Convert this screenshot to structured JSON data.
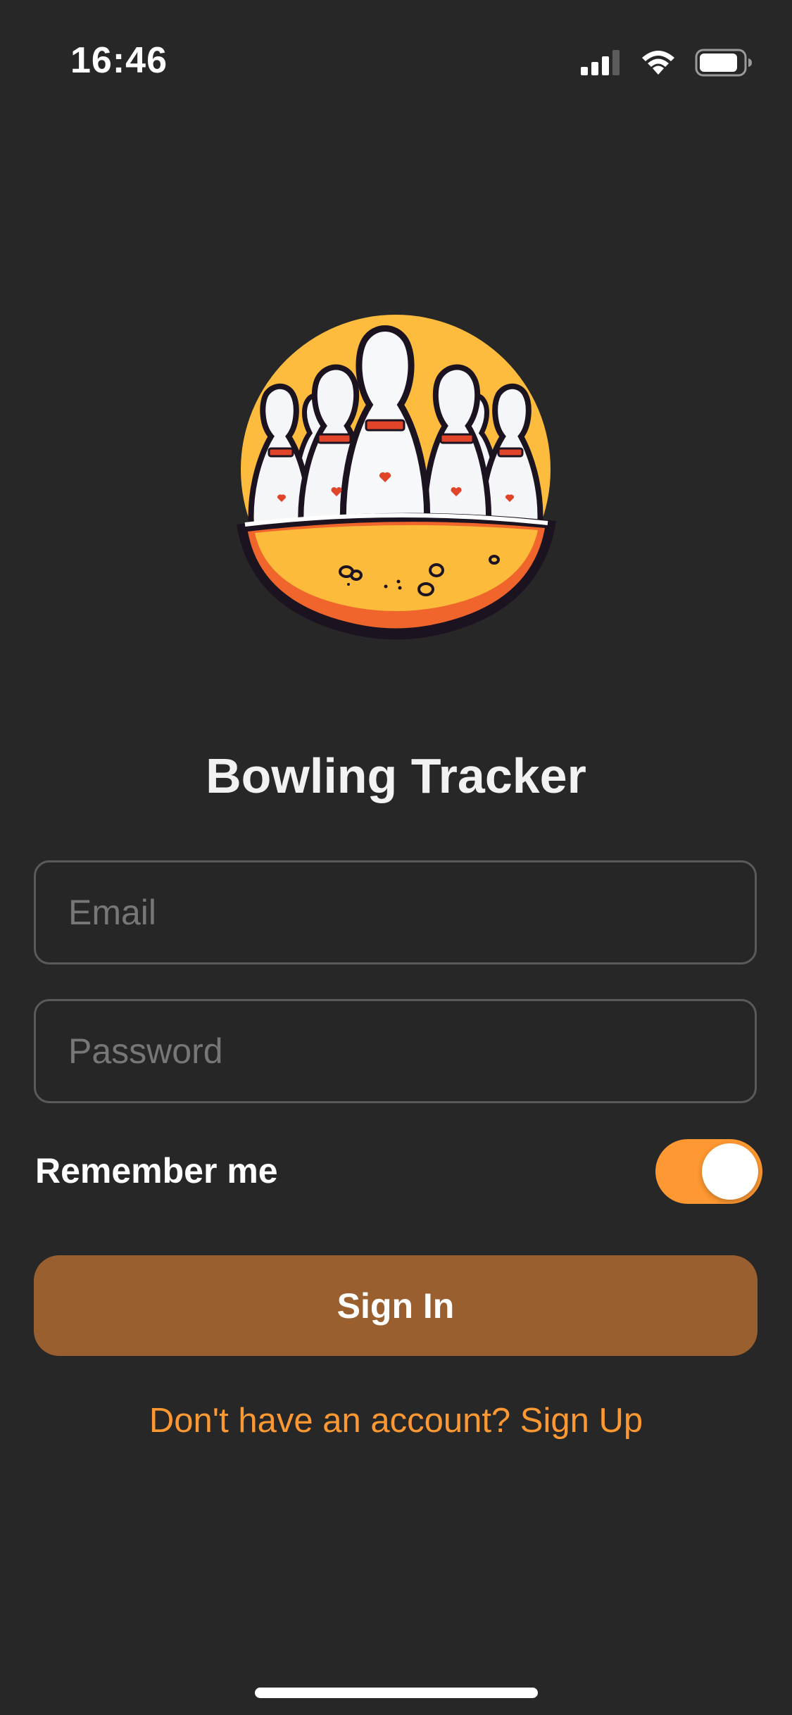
{
  "status_bar": {
    "time": "16:46",
    "icons": [
      "signal-icon",
      "wifi-icon",
      "battery-icon"
    ]
  },
  "logo": {
    "icon": "bowling-pins-logo-icon",
    "colors": {
      "sun": "#fdbc3e",
      "bowl_outer": "#f0652b",
      "bowl_inner": "#fdbb3b",
      "pin_stripe": "#e0452a",
      "outline": "#1c1320"
    }
  },
  "title": "Bowling Tracker",
  "form": {
    "email": {
      "value": "",
      "placeholder": "Email"
    },
    "password": {
      "value": "",
      "placeholder": "Password"
    },
    "remember_label": "Remember me",
    "remember_on": true,
    "sign_in_label": "Sign In",
    "signup_link": "Don't have an account? Sign Up"
  },
  "colors": {
    "background": "#272727",
    "accent": "#fe9832",
    "button": "#9a5f2e",
    "field_border": "#5a5a5a"
  }
}
